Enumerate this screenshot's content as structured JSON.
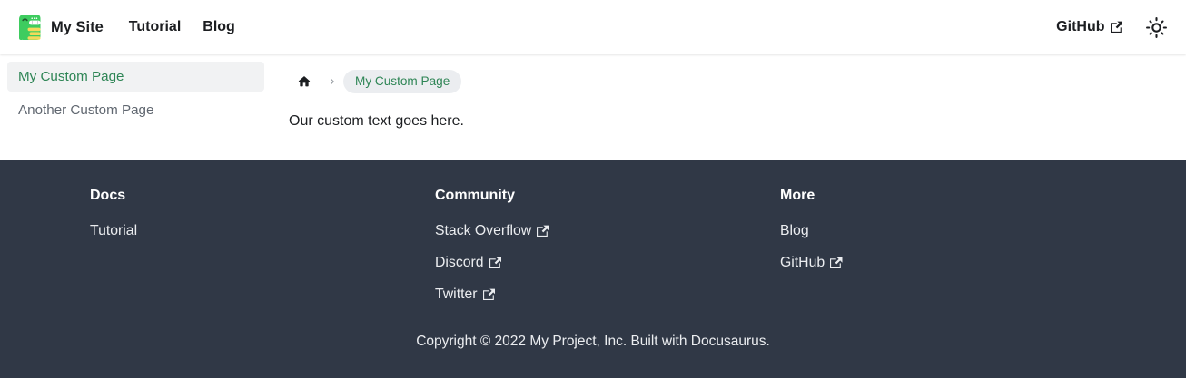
{
  "navbar": {
    "brand": "My Site",
    "items": [
      {
        "label": "Tutorial"
      },
      {
        "label": "Blog"
      }
    ],
    "github_label": "GitHub",
    "icons": {
      "brand_logo": "docusaurus-dinosaur-logo",
      "github_external": "external-link-icon",
      "theme_toggle": "sun-icon"
    }
  },
  "sidebar": {
    "items": [
      {
        "label": "My Custom Page",
        "active": true
      },
      {
        "label": "Another Custom Page",
        "active": false
      }
    ]
  },
  "breadcrumb": {
    "home_icon": "home-icon",
    "separator_icon": "chevron-right-icon",
    "current": "My Custom Page"
  },
  "content": {
    "text": "Our custom text goes here."
  },
  "footer": {
    "columns": [
      {
        "title": "Docs",
        "links": [
          {
            "label": "Tutorial",
            "external": false
          }
        ]
      },
      {
        "title": "Community",
        "links": [
          {
            "label": "Stack Overflow",
            "external": true
          },
          {
            "label": "Discord",
            "external": true
          },
          {
            "label": "Twitter",
            "external": true
          }
        ]
      },
      {
        "title": "More",
        "links": [
          {
            "label": "Blog",
            "external": false
          },
          {
            "label": "GitHub",
            "external": true
          }
        ]
      }
    ],
    "copyright": "Copyright © 2022 My Project, Inc. Built with Docusaurus."
  },
  "colors": {
    "primary_green": "#2e8555",
    "text": "#1c1e21",
    "muted_text": "#606770",
    "border": "#dadde1",
    "badge_bg": "#ebedf0",
    "footer_bg": "#303846",
    "footer_text": "#ebedf0",
    "logo_green": "#3ecc5f",
    "logo_yellow": "#f3da5b"
  }
}
